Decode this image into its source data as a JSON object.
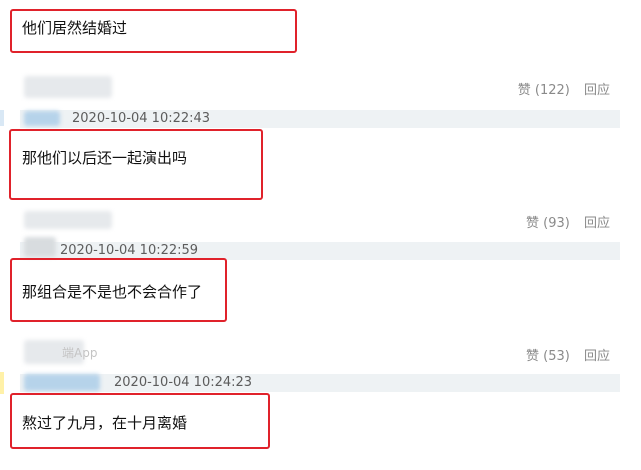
{
  "comments": [
    {
      "text": "他们居然结婚过"
    },
    {
      "text": "那他们以后还一起演出吗",
      "likes": "赞 (122)",
      "reply": "回应",
      "time": "2020-10-04 10:22:43"
    },
    {
      "text": "那组合是不是也不会合作了",
      "likes": "赞 (93)",
      "reply": "回应",
      "time": "2020-10-04 10:22:59"
    },
    {
      "text": "熬过了九月，在十月离婚",
      "likes": "赞 (53)",
      "reply": "回应",
      "time": "2020-10-04 10:24:23",
      "source_fragment": "端App"
    }
  ],
  "colors": {
    "highlight_border": "#e0222b",
    "meta_text": "#8a8a8a",
    "time_bar": "#eef2f4"
  }
}
